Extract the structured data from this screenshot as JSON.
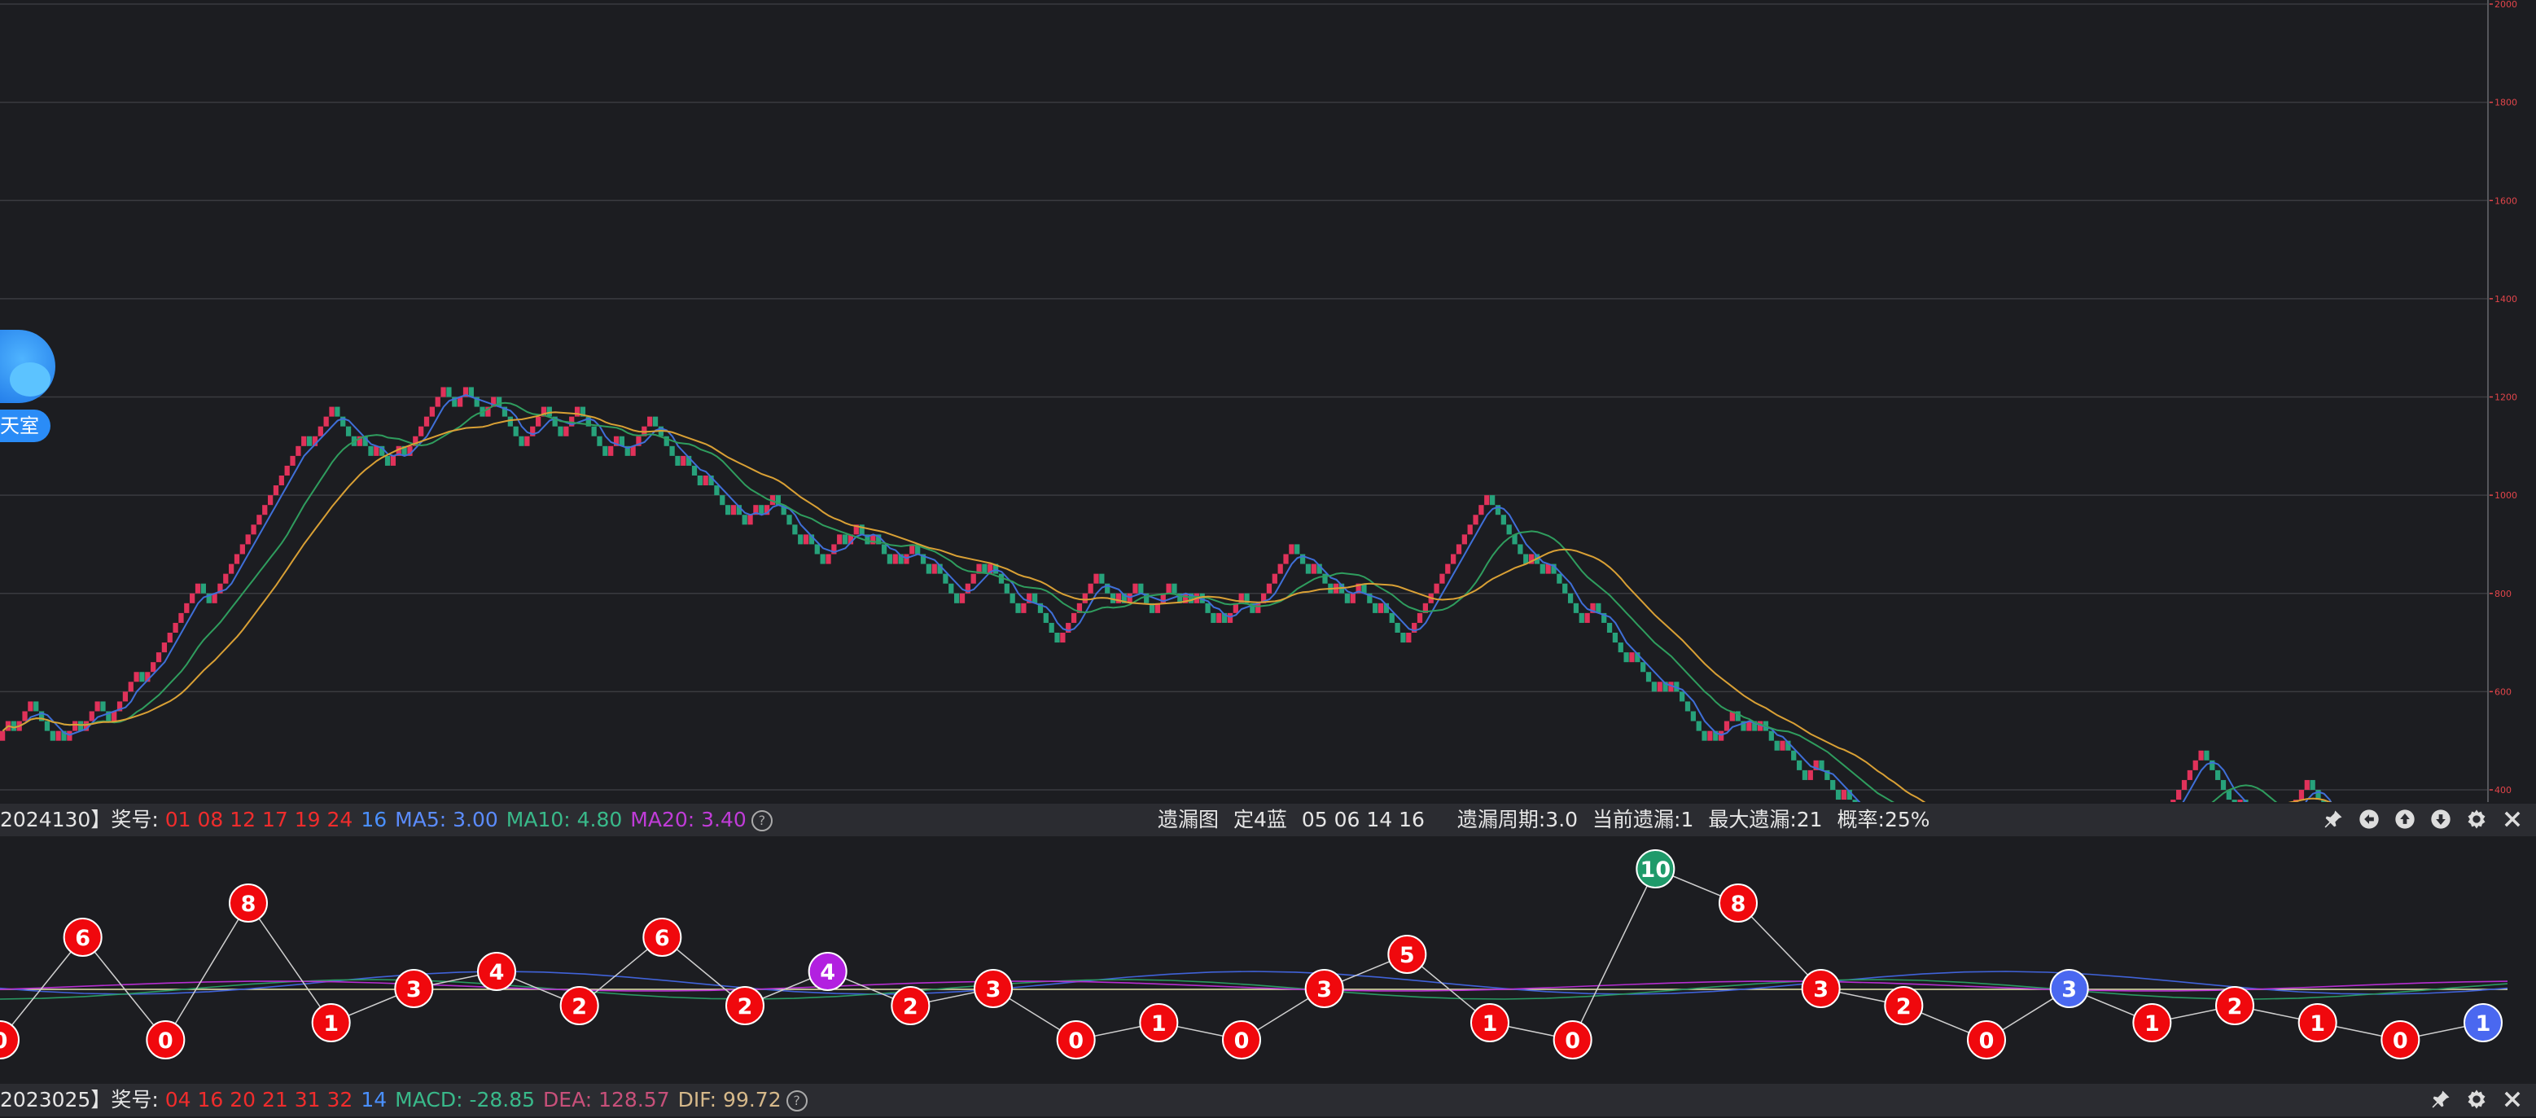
{
  "chart_data": [
    {
      "type": "renko",
      "title": "",
      "ylim": [
        400,
        2000
      ],
      "yticks": [
        400,
        600,
        800,
        1000,
        1200,
        1400,
        1600,
        1800,
        2000
      ],
      "grid": true,
      "box_size": 20,
      "bricks": [
        1,
        1,
        -1,
        1,
        1,
        1,
        -1,
        -1,
        -1,
        -1,
        1,
        -1,
        1,
        1,
        -1,
        1,
        1,
        1,
        -1,
        -1,
        1,
        1,
        1,
        1,
        1,
        -1,
        1,
        1,
        1,
        1,
        1,
        1,
        1,
        1,
        1,
        1,
        -1,
        -1,
        1,
        1,
        1,
        1,
        1,
        1,
        1,
        1,
        1,
        1,
        1,
        1,
        1,
        1,
        1,
        1,
        1,
        -1,
        1,
        1,
        1,
        1,
        -1,
        -1,
        -1,
        -1,
        1,
        -1,
        -1,
        1,
        -1,
        -1,
        1,
        1,
        -1,
        1,
        1,
        1,
        1,
        1,
        1,
        1,
        -1,
        -1,
        1,
        1,
        -1,
        -1,
        -1,
        1,
        1,
        -1,
        -1,
        -1,
        -1,
        -1,
        1,
        1,
        1,
        1,
        -1,
        -1,
        -1,
        1,
        1,
        1,
        -1,
        -1,
        -1,
        -1,
        -1,
        1,
        1,
        -1,
        -1,
        1,
        1,
        1,
        1,
        -1,
        -1,
        -1,
        -1,
        -1,
        1,
        -1,
        -1,
        -1,
        1,
        -1,
        -1,
        -1,
        -1,
        1,
        -1,
        -1,
        1,
        1,
        -1,
        1,
        1,
        -1,
        -1,
        -1,
        -1,
        -1,
        1,
        -1,
        -1,
        -1,
        1,
        1,
        1,
        -1,
        1,
        1,
        -1,
        -1,
        1,
        -1,
        -1,
        -1,
        1,
        -1,
        1,
        1,
        -1,
        -1,
        -1,
        1,
        -1,
        -1,
        -1,
        -1,
        1,
        1,
        1,
        1,
        -1,
        1,
        -1,
        -1,
        -1,
        -1,
        -1,
        1,
        1,
        -1,
        -1,
        -1,
        -1,
        -1,
        1,
        1,
        1,
        1,
        1,
        1,
        1,
        -1,
        -1,
        -1,
        1,
        -1,
        1,
        1,
        -1,
        -1,
        -1,
        1,
        1,
        1,
        -1,
        -1,
        1,
        -1,
        1,
        -1,
        -1,
        -1,
        1,
        -1,
        1,
        1,
        1,
        -1,
        -1,
        1,
        1,
        1,
        1,
        1,
        1,
        1,
        -1,
        -1,
        -1,
        1,
        -1,
        -1,
        -1,
        1,
        -1,
        -1,
        1,
        1,
        -1,
        -1,
        -1,
        1,
        -1,
        -1,
        -1,
        -1,
        1,
        1,
        1,
        1,
        1,
        1,
        1,
        1,
        1,
        1,
        1,
        1,
        1,
        1,
        1,
        -1,
        -1,
        -1,
        -1,
        -1,
        -1,
        -1,
        1,
        -1,
        -1,
        1,
        -1,
        -1,
        -1,
        -1,
        -1,
        -1,
        1,
        1,
        -1,
        -1,
        -1,
        -1,
        -1,
        -1,
        1,
        -1,
        -1,
        -1,
        -1,
        1,
        -1,
        1,
        -1,
        -1,
        -1,
        -1,
        -1,
        -1,
        1,
        -1,
        1,
        1,
        1,
        -1,
        -1,
        1,
        -1,
        1,
        -1,
        -1,
        -1,
        1,
        -1,
        -1,
        -1,
        -1,
        1,
        1,
        -1,
        -1,
        -1,
        -1,
        1,
        -1,
        -1,
        -1,
        1,
        -1,
        -1,
        1,
        -1,
        1,
        -1,
        -1,
        1,
        1,
        -1,
        -1,
        1,
        1,
        -1,
        -1,
        -1,
        1,
        1,
        1,
        -1,
        -1,
        1,
        1,
        -1,
        -1,
        -1,
        -1,
        1,
        1,
        -1,
        -1,
        -1,
        -1,
        1,
        -1,
        -1,
        1,
        1,
        1,
        -1,
        1,
        1,
        -1,
        -1,
        -1,
        1,
        1,
        1,
        -1,
        1,
        1,
        1,
        1,
        1,
        1,
        1,
        1,
        1,
        1,
        1,
        -1,
        -1,
        -1,
        -1,
        -1,
        -1,
        1,
        -1,
        -1,
        -1,
        -1,
        -1,
        1,
        1,
        1,
        1,
        1,
        1,
        1,
        -1,
        -1,
        -1,
        -1,
        -1,
        -1,
        -1,
        -1,
        -1,
        1,
        -1,
        -1,
        -1,
        -1,
        -1,
        -1,
        1,
        1,
        1,
        -1,
        1,
        1,
        1,
        1,
        -1,
        1,
        1,
        1,
        1,
        1,
        1
      ],
      "brick_start": 500,
      "ma_lines": [
        {
          "color": "#3f6fd8",
          "window": 5
        },
        {
          "color": "#2f9d5e",
          "window": 15
        },
        {
          "color": "#d9a035",
          "window": 25
        }
      ]
    },
    {
      "type": "line",
      "title": "",
      "values": [
        0,
        6,
        0,
        8,
        1,
        3,
        4,
        2,
        6,
        2,
        4,
        2,
        3,
        0,
        1,
        0,
        3,
        5,
        1,
        0,
        10,
        8,
        3,
        2,
        0,
        3,
        1,
        2,
        1,
        0,
        1
      ],
      "labels_on_points": true,
      "highlight": {
        "10": "purple",
        "20": "green",
        "25": "blue",
        "30": "blue"
      },
      "point_colors": {
        "red": "#f0080d",
        "purple": "#b220e0",
        "green": "#1f9a6a",
        "blue": "#4a68f0"
      }
    }
  ],
  "bar1": {
    "prefix": "2024130】奖号:",
    "balls_red": "01 08 12 17 19 24",
    "ball_blue": "16",
    "ma5": "MA5: 3.00",
    "ma10": "MA10: 4.80",
    "ma20": "MA20: 3.40",
    "help": "?",
    "chart_name": "遗漏图",
    "mode": "定4蓝",
    "numbers": "05 06 14 16",
    "cycle": "遗漏周期:3.0",
    "current": "当前遗漏:1",
    "max": "最大遗漏:21",
    "prob": "概率:25%"
  },
  "bar2": {
    "prefix": "2023025】奖号:",
    "balls_red": "04 16 20 21 31 32",
    "ball_blue": "14",
    "macd": "MACD: -28.85",
    "dea": "DEA: 128.57",
    "dif": "DIF: 99.72",
    "help": "?"
  },
  "chat": {
    "label": "天室"
  },
  "icons": [
    "pin-icon",
    "undo-icon",
    "up-icon",
    "down-icon",
    "settings-icon",
    "close-icon"
  ]
}
